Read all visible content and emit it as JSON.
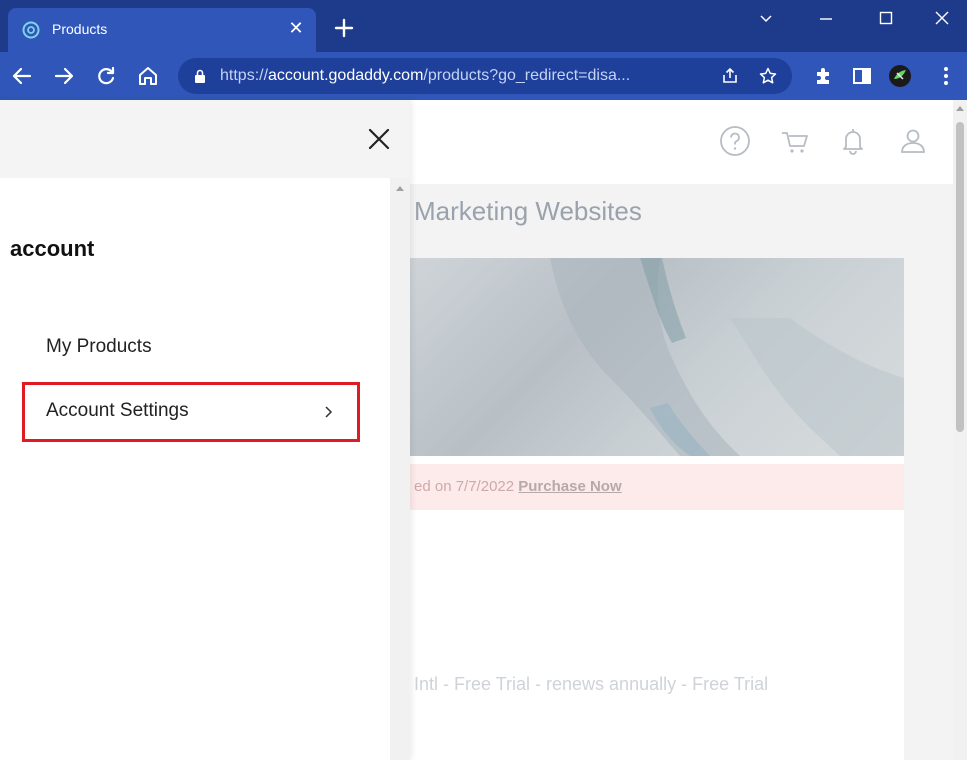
{
  "browser": {
    "tab": {
      "title": "Products",
      "close_icon": "close-icon"
    },
    "new_tab_icon": "plus-icon",
    "window_controls": [
      "chevron-down-icon",
      "minimize-icon",
      "maximize-icon",
      "close-icon"
    ],
    "nav": [
      "back-icon",
      "forward-icon",
      "reload-icon",
      "home-icon"
    ],
    "url": {
      "scheme": "https://",
      "domain": "account.godaddy.com",
      "path": "/products?go_redirect=disa..."
    },
    "omnibox_icons": [
      "share-icon",
      "bookmark-star-icon"
    ],
    "extension_icons": [
      "puzzle-icon",
      "side-panel-icon",
      "profile-avatar-icon",
      "menu-dots-icon"
    ]
  },
  "drawer": {
    "heading": "account",
    "close_icon": "close-icon",
    "items": [
      {
        "label": "My Products"
      },
      {
        "label": "Account Settings",
        "icon": "chevron-right-icon",
        "highlighted": true
      }
    ]
  },
  "page": {
    "header_icons": [
      "help-icon",
      "cart-icon",
      "bell-icon",
      "user-icon"
    ],
    "section_title": "Marketing Websites",
    "notice": {
      "text": "ed on 7/7/2022 ",
      "link": "Purchase Now"
    },
    "product_line": "Intl - Free Trial - renews annually - Free Trial"
  },
  "colors": {
    "chrome_frame": "#1e3a8a",
    "chrome_toolbar": "#2f56b8",
    "highlight_border": "#e01b24"
  }
}
